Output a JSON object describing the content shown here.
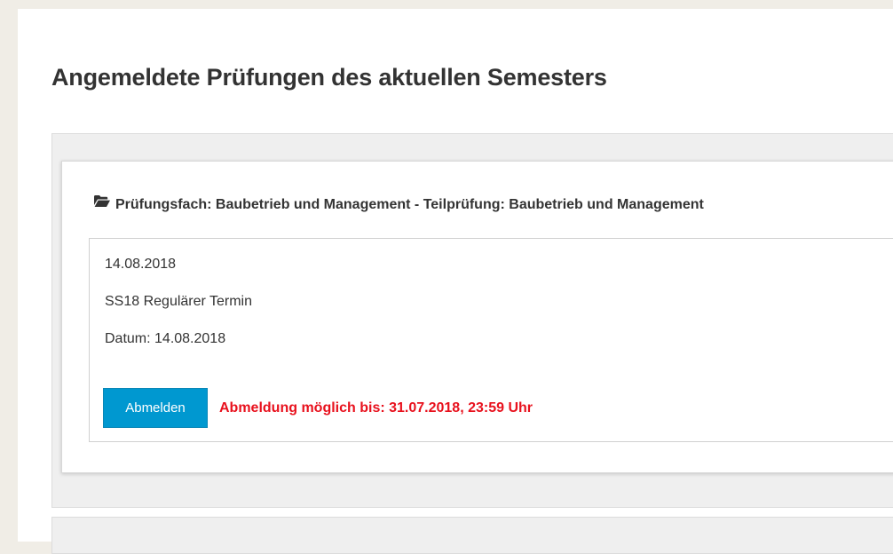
{
  "page": {
    "title": "Angemeldete Prüfungen des aktuellen Semesters"
  },
  "exam": {
    "heading": "Prüfungsfach: Baubetrieb und Management - Teilprüfung: Baubetrieb und Management",
    "heading_icon": "folder-open-icon",
    "date": "14.08.2018",
    "term": "SS18 Regulärer Termin",
    "datum": "Datum: 14.08.2018",
    "unregister_label": "Abmelden",
    "deadline_text": "Abmeldung möglich bis: 31.07.2018, 23:59 Uhr"
  },
  "colors": {
    "button": "#0098d0",
    "deadline": "#e8111d",
    "background": "#f0ede6"
  }
}
